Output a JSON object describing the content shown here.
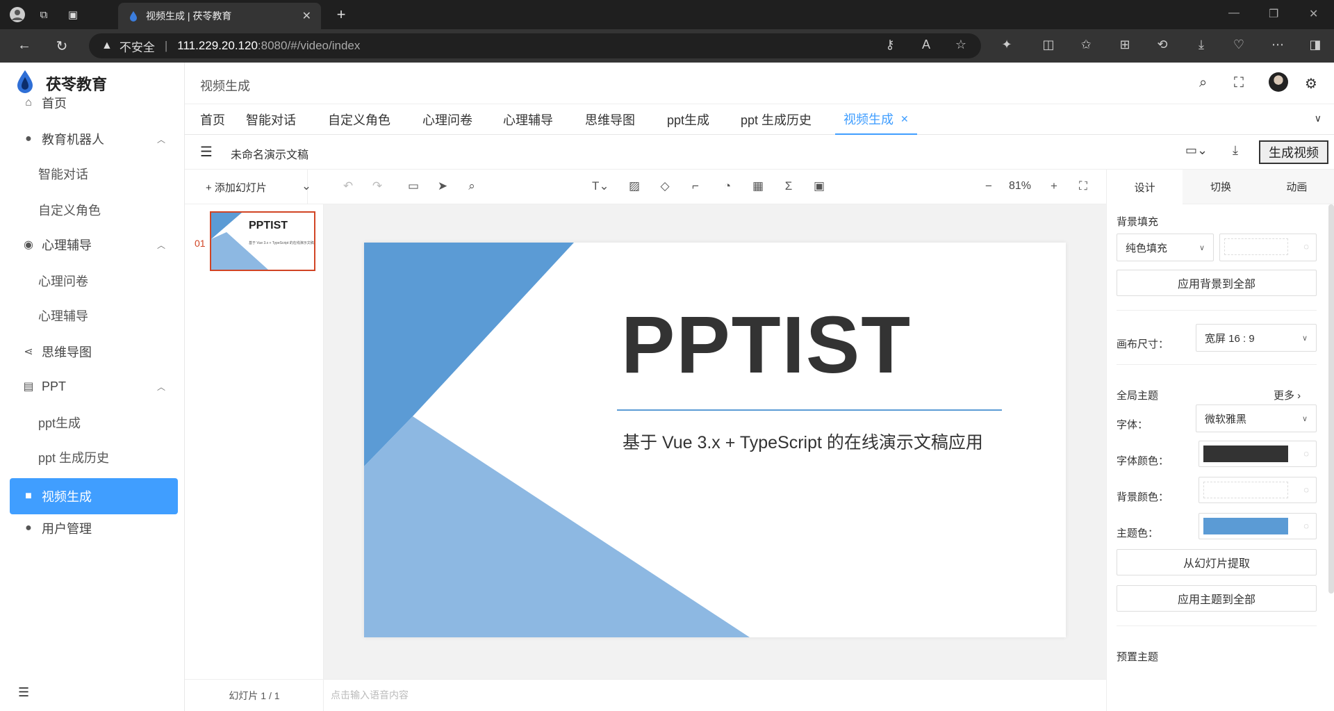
{
  "browser": {
    "tab_title": "视频生成 | 茯苓教育",
    "security_label": "不安全",
    "url_host": "111.229.20.120",
    "url_rest": ":8080/#/video/index"
  },
  "app": {
    "logo_text": "茯苓教育",
    "breadcrumb": "视频生成"
  },
  "sidebar": {
    "items": [
      {
        "label": "首页"
      },
      {
        "label": "教育机器人"
      },
      {
        "label": "智能对话"
      },
      {
        "label": "自定义角色"
      },
      {
        "label": "心理辅导"
      },
      {
        "label": "心理问卷"
      },
      {
        "label": "心理辅导"
      },
      {
        "label": "思维导图"
      },
      {
        "label": "PPT"
      },
      {
        "label": "ppt生成"
      },
      {
        "label": "ppt 生成历史"
      },
      {
        "label": "视频生成"
      },
      {
        "label": "用户管理"
      }
    ]
  },
  "tabs": [
    {
      "label": "首页"
    },
    {
      "label": "智能对话"
    },
    {
      "label": "自定义角色"
    },
    {
      "label": "心理问卷"
    },
    {
      "label": "心理辅导"
    },
    {
      "label": "思维导图"
    },
    {
      "label": "ppt生成"
    },
    {
      "label": "ppt 生成历史"
    },
    {
      "label": "视频生成"
    }
  ],
  "editor": {
    "doc_title": "未命名演示文稿",
    "generate_video": "生成视频",
    "add_slide": "+ 添加幻灯片",
    "zoom": "81%",
    "slide_number": "01",
    "slide_counter": "幻灯片 1 / 1",
    "notes_placeholder": "点击输入语音内容",
    "slide": {
      "title": "PPTIST",
      "subtitle": "基于 Vue 3.x + TypeScript 的在线演示文稿应用"
    }
  },
  "panel": {
    "tabs": [
      "设计",
      "切换",
      "动画"
    ],
    "bg_fill_label": "背景填充",
    "bg_fill_type": "纯色填充",
    "apply_bg_all": "应用背景到全部",
    "canvas_size_label": "画布尺寸：",
    "canvas_size_value": "宽屏 16 : 9",
    "global_theme_label": "全局主题",
    "more": "更多",
    "font_label": "字体：",
    "font_value": "微软雅黑",
    "font_color_label": "字体颜色：",
    "bg_color_label": "背景颜色：",
    "theme_color_label": "主题色：",
    "extract_from_slide": "从幻灯片提取",
    "apply_theme_all": "应用主题到全部",
    "preset_theme_label": "预置主题",
    "colors": {
      "font": "#333333",
      "bg": "#ffffff",
      "theme": "#5b9bd5"
    }
  }
}
